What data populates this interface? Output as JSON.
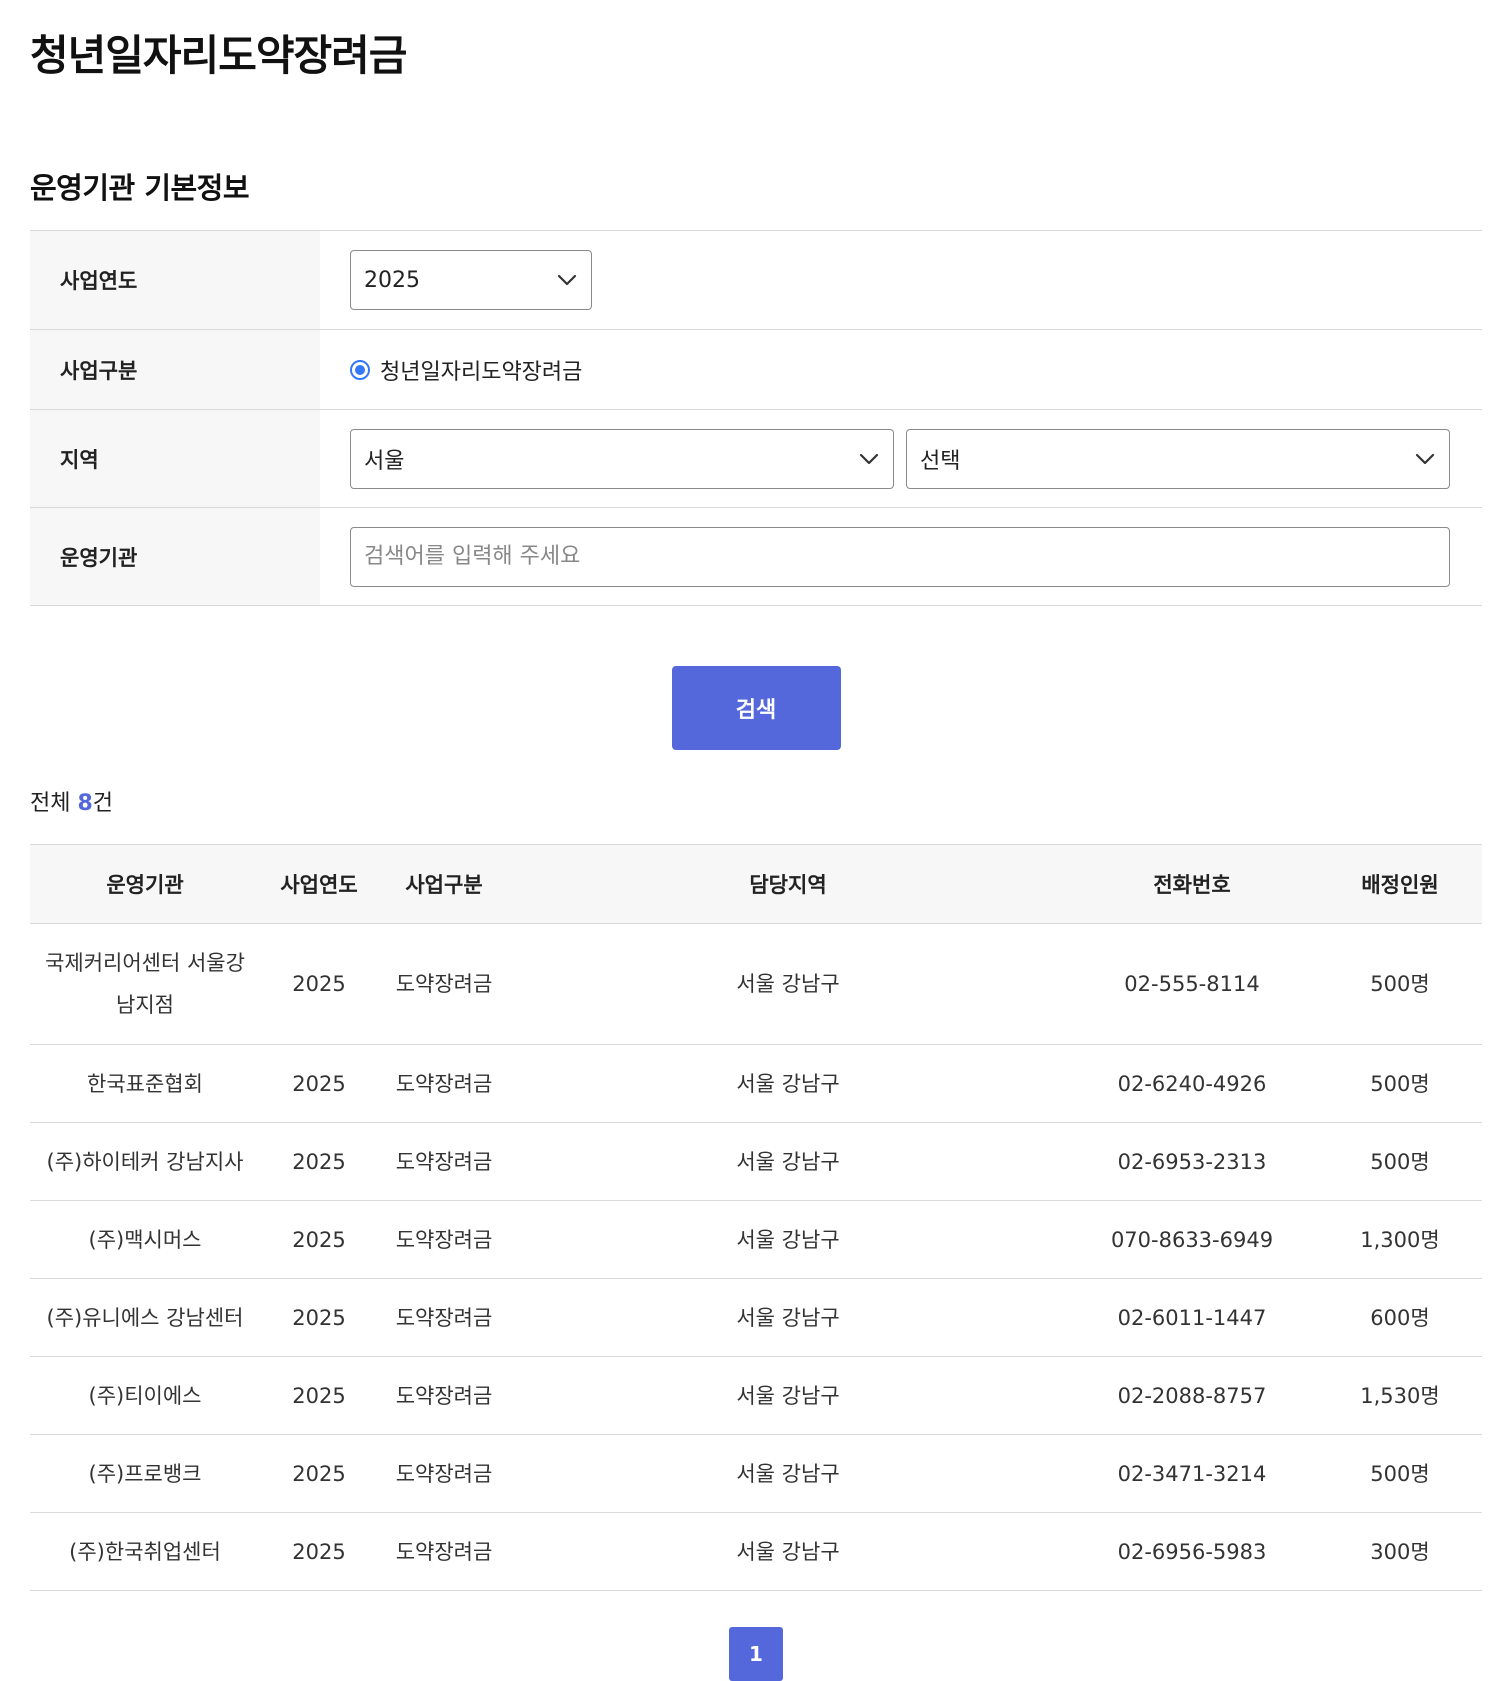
{
  "page": {
    "title": "청년일자리도약장려금"
  },
  "section": {
    "title": "운영기관 기본정보"
  },
  "form": {
    "year_label": "사업연도",
    "year_value": "2025",
    "type_label": "사업구분",
    "type_option": "청년일자리도약장려금",
    "region_label": "지역",
    "region_value": "서울",
    "district_value": "선택",
    "org_label": "운영기관",
    "org_placeholder": "검색어를 입력해 주세요"
  },
  "search": {
    "button_label": "검색"
  },
  "results": {
    "total_prefix": "전체",
    "total_count": "8",
    "total_suffix": "건",
    "headers": [
      "운영기관",
      "사업연도",
      "사업구분",
      "담당지역",
      "전화번호",
      "배정인원"
    ],
    "rows": [
      [
        "국제커리어센터 서울강남지점",
        "2025",
        "도약장려금",
        "서울 강남구",
        "02-555-8114",
        "500명"
      ],
      [
        "한국표준협회",
        "2025",
        "도약장려금",
        "서울 강남구",
        "02-6240-4926",
        "500명"
      ],
      [
        "(주)하이테커 강남지사",
        "2025",
        "도약장려금",
        "서울 강남구",
        "02-6953-2313",
        "500명"
      ],
      [
        "(주)맥시머스",
        "2025",
        "도약장려금",
        "서울 강남구",
        "070-8633-6949",
        "1,300명"
      ],
      [
        "(주)유니에스 강남센터",
        "2025",
        "도약장려금",
        "서울 강남구",
        "02-6011-1447",
        "600명"
      ],
      [
        "(주)티이에스",
        "2025",
        "도약장려금",
        "서울 강남구",
        "02-2088-8757",
        "1,530명"
      ],
      [
        "(주)프로뱅크",
        "2025",
        "도약장려금",
        "서울 강남구",
        "02-3471-3214",
        "500명"
      ],
      [
        "(주)한국취업센터",
        "2025",
        "도약장려금",
        "서울 강남구",
        "02-6956-5983",
        "300명"
      ]
    ]
  },
  "pagination": {
    "current": "1"
  },
  "colors": {
    "accent": "#5468db",
    "radio": "#3478f6",
    "label_bg": "#f7f7f7",
    "border": "#d9d9d9"
  },
  "icons": {
    "dropdown": "chevron-down-icon"
  }
}
